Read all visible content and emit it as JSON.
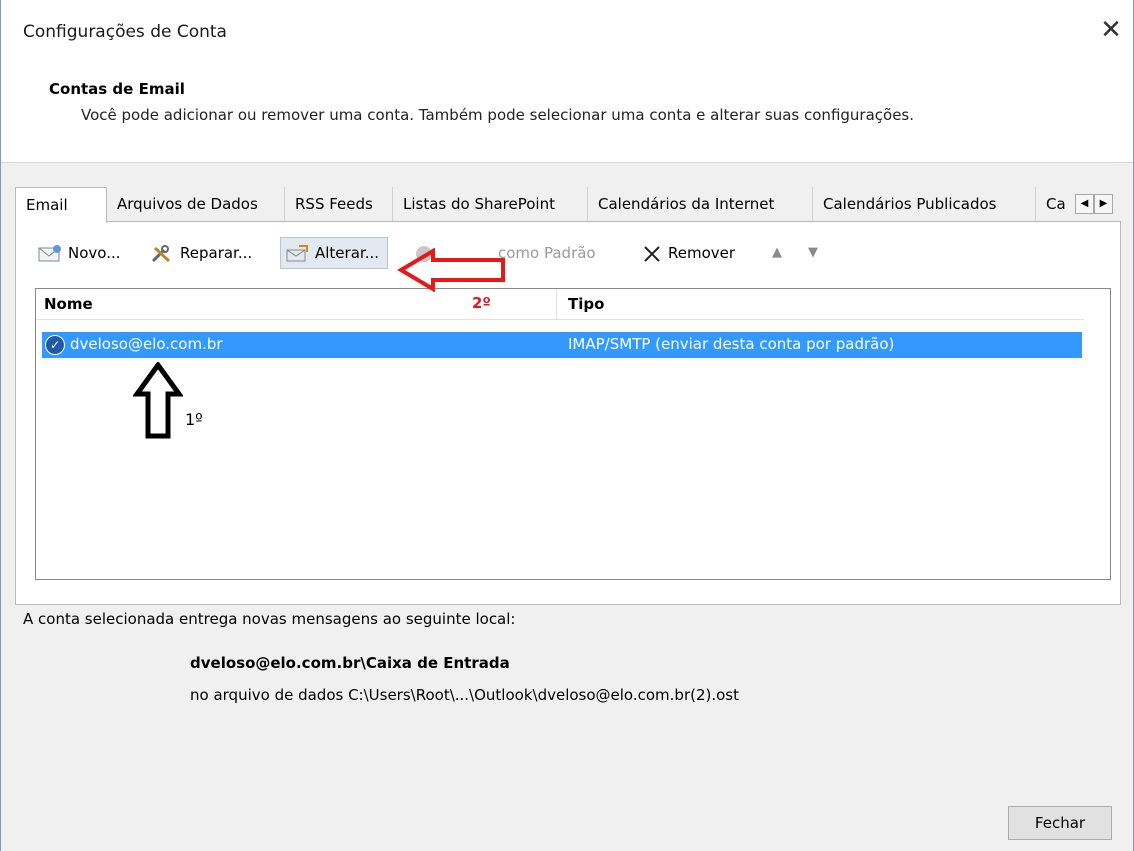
{
  "window": {
    "title": "Configurações de Conta"
  },
  "header": {
    "heading": "Contas de Email",
    "description": "Você pode adicionar ou remover uma conta. Também pode selecionar uma conta e alterar suas configurações."
  },
  "tabs": [
    {
      "label": "Email",
      "active": true
    },
    {
      "label": "Arquivos de Dados"
    },
    {
      "label": "RSS Feeds"
    },
    {
      "label": "Listas do SharePoint"
    },
    {
      "label": "Calendários da Internet"
    },
    {
      "label": "Calendários Publicados"
    },
    {
      "label": "Ca"
    }
  ],
  "toolbar": {
    "novo": "Novo...",
    "reparar": "Reparar...",
    "alterar": "Alterar...",
    "definir_padrao": "como Padrão",
    "remover": "Remover"
  },
  "accounts_table": {
    "columns": [
      "Nome",
      "Tipo"
    ],
    "rows": [
      {
        "nome": "dveloso@elo.com.br",
        "tipo": "IMAP/SMTP (enviar desta conta por padrão)",
        "selected": true
      }
    ]
  },
  "annotations": {
    "step1": "1º",
    "step2": "2º"
  },
  "delivery": {
    "label": "A conta selecionada entrega novas mensagens ao seguinte local:",
    "location": "dveloso@elo.com.br\\Caixa de Entrada",
    "data_file": "no arquivo de dados C:\\Users\\Root\\...\\Outlook\\dveloso@elo.com.br(2).ost"
  },
  "footer": {
    "close_label": "Fechar"
  },
  "colors": {
    "selection": "#3399ff",
    "annotation_red": "#e21a1a"
  }
}
